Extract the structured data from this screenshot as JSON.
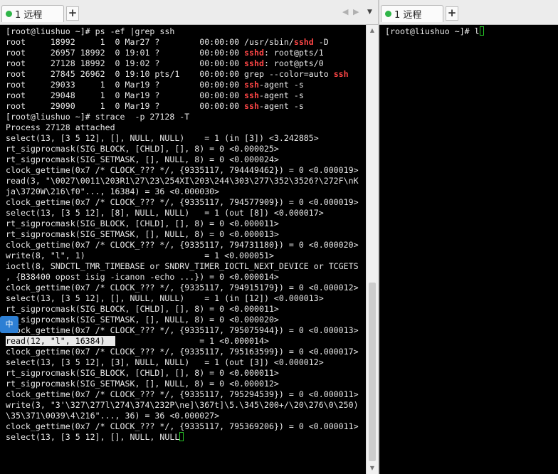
{
  "left_session": {
    "tab_label": "1 远程",
    "add_tab_symbol": "+",
    "nav_prev_symbol": "◀",
    "nav_next_symbol": "▶",
    "dropdown_symbol": "▼",
    "lines": [
      [
        {
          "t": "[root@liushuo ~]# ps -ef |grep ssh"
        }
      ],
      [
        {
          "t": "root     18992     1  0 Mar27 ?        00:00:00 /usr/sbin/"
        },
        {
          "t": "sshd",
          "c": "red"
        },
        {
          "t": " -D"
        }
      ],
      [
        {
          "t": "root     26957 18992  0 19:01 ?        00:00:00 "
        },
        {
          "t": "sshd",
          "c": "red"
        },
        {
          "t": ": root@pts/1"
        }
      ],
      [
        {
          "t": "root     27128 18992  0 19:02 ?        00:00:00 "
        },
        {
          "t": "sshd",
          "c": "red"
        },
        {
          "t": ": root@pts/0"
        }
      ],
      [
        {
          "t": "root     27845 26962  0 19:10 pts/1    00:00:00 grep --color=auto "
        },
        {
          "t": "ssh",
          "c": "red"
        }
      ],
      [
        {
          "t": "root     29033     1  0 Mar19 ?        00:00:00 "
        },
        {
          "t": "ssh",
          "c": "red"
        },
        {
          "t": "-agent -s"
        }
      ],
      [
        {
          "t": "root     29048     1  0 Mar19 ?        00:00:00 "
        },
        {
          "t": "ssh",
          "c": "red"
        },
        {
          "t": "-agent -s"
        }
      ],
      [
        {
          "t": "root     29090     1  0 Mar19 ?        00:00:00 "
        },
        {
          "t": "ssh",
          "c": "red"
        },
        {
          "t": "-agent -s"
        }
      ],
      [
        {
          "t": "[root@liushuo ~]# strace  -p 27128 -T"
        }
      ],
      [
        {
          "t": "Process 27128 attached"
        }
      ],
      [
        {
          "t": "select(13, [3 5 12], [], NULL, NULL)    = 1 (in [3]) <3.242885>"
        }
      ],
      [
        {
          "t": "rt_sigprocmask(SIG_BLOCK, [CHLD], [], 8) = 0 <0.000025>"
        }
      ],
      [
        {
          "t": "rt_sigprocmask(SIG_SETMASK, [], NULL, 8) = 0 <0.000024>"
        }
      ],
      [
        {
          "t": "clock_gettime(0x7 /* CLOCK_??? */, {9335117, 794449462}) = 0 <0.000019>"
        }
      ],
      [
        {
          "t": "read(3, \"\\0027\\0011\\203R1\\27\\23\\254XI\\203\\244\\303\\277\\352\\3526?\\272F\\nK"
        }
      ],
      [
        {
          "t": "ja\\3720W\\216\\f0\"..., 16384) = 36 <0.000030>"
        }
      ],
      [
        {
          "t": "clock_gettime(0x7 /* CLOCK_??? */, {9335117, 794577909}) = 0 <0.000019>"
        }
      ],
      [
        {
          "t": "select(13, [3 5 12], [8], NULL, NULL)   = 1 (out [8]) <0.000017>"
        }
      ],
      [
        {
          "t": "rt_sigprocmask(SIG_BLOCK, [CHLD], [], 8) = 0 <0.000011>"
        }
      ],
      [
        {
          "t": "rt_sigprocmask(SIG_SETMASK, [], NULL, 8) = 0 <0.000013>"
        }
      ],
      [
        {
          "t": "clock_gettime(0x7 /* CLOCK_??? */, {9335117, 794731180}) = 0 <0.000020>"
        }
      ],
      [
        {
          "t": "write(8, \"l\", 1)                        = 1 <0.000051>"
        }
      ],
      [
        {
          "t": "ioctl(8, SNDCTL_TMR_TIMEBASE or SNDRV_TIMER_IOCTL_NEXT_DEVICE or TCGETS"
        }
      ],
      [
        {
          "t": ", {B38400 opost isig -icanon -echo ...}) = 0 <0.000014>"
        }
      ],
      [
        {
          "t": "clock_gettime(0x7 /* CLOCK_??? */, {9335117, 794915179}) = 0 <0.000012>"
        }
      ],
      [
        {
          "t": "select(13, [3 5 12], [], NULL, NULL)    = 1 (in [12]) <0.000013>"
        }
      ],
      [
        {
          "t": "rt_sigprocmask(SIG_BLOCK, [CHLD], [], 8) = 0 <0.000011>"
        }
      ],
      [
        {
          "t": "rt_sigprocmask(SIG_SETMASK, [], NULL, 8) = 0 <0.000020>"
        }
      ],
      [
        {
          "t": "clock_gettime(0x7 /* CLOCK_??? */, {9335117, 795075944}) = 0 <0.000013>"
        }
      ],
      [
        {
          "t": "read(12, \"l\", 16384)  ",
          "c": "hl"
        },
        {
          "t": "                 = 1 <0.000014>"
        }
      ],
      [
        {
          "t": "clock_gettime(0x7 /* CLOCK_??? */, {9335117, 795163599}) = 0 <0.000017>"
        }
      ],
      [
        {
          "t": "select(13, [3 5 12], [3], NULL, NULL)   = 1 (out [3]) <0.000012>"
        }
      ],
      [
        {
          "t": "rt_sigprocmask(SIG_BLOCK, [CHLD], [], 8) = 0 <0.000011>"
        }
      ],
      [
        {
          "t": "rt_sigprocmask(SIG_SETMASK, [], NULL, 8) = 0 <0.000012>"
        }
      ],
      [
        {
          "t": "clock_gettime(0x7 /* CLOCK_??? */, {9335117, 795294539}) = 0 <0.000011>"
        }
      ],
      [
        {
          "t": "write(3, \"3'\\327\\277l\\274\\374\\232P\\ne]\\367t]\\5.\\345\\200+/\\20\\276\\0\\250)"
        }
      ],
      [
        {
          "t": "\\35\\371\\0039\\4\\216\"..., 36) = 36 <0.000027>"
        }
      ],
      [
        {
          "t": "clock_gettime(0x7 /* CLOCK_??? */, {9335117, 795369206}) = 0 <0.000011>"
        }
      ],
      [
        {
          "t": "select(13, [3 5 12], [], NULL, NULL"
        },
        {
          "cursor": true
        }
      ]
    ]
  },
  "right_session": {
    "tab_label": "1 远程",
    "add_tab_symbol": "+",
    "lines": [
      [
        {
          "t": "[root@liushuo ~]# l"
        },
        {
          "cursor": true
        }
      ]
    ]
  },
  "ime_indicator": {
    "label": "中"
  },
  "scrollbar": {
    "up_symbol": "▲",
    "down_symbol": "▼",
    "position_fraction": 1.0
  },
  "colors": {
    "terminal_bg": "#000000",
    "terminal_fg": "#e9e9e9",
    "match_red": "#ff4646",
    "cursor_green": "#27c627",
    "status_dot_green": "#2fb548"
  }
}
